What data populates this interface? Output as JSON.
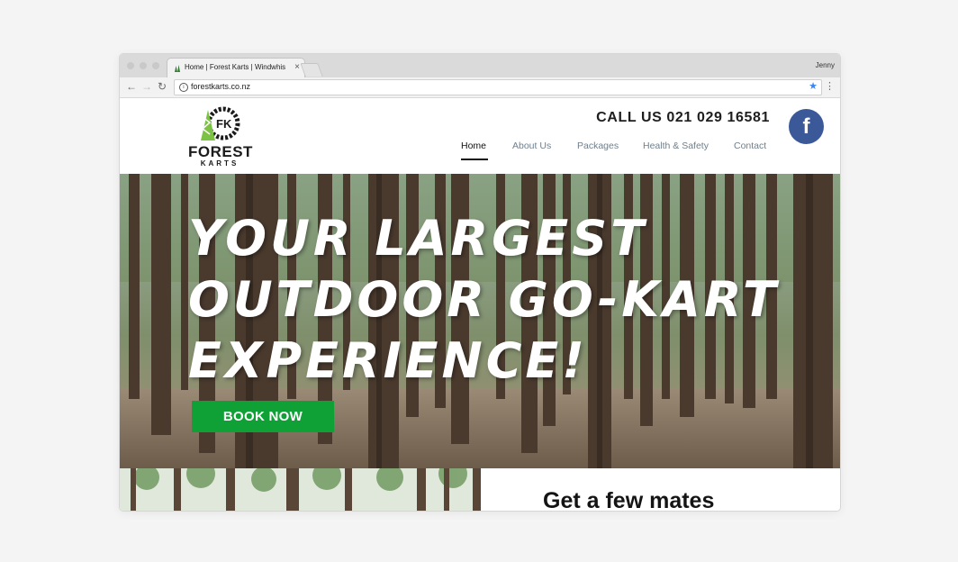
{
  "browser": {
    "tab_title": "Home | Forest Karts | Windwhistle",
    "tab_close": "×",
    "profile_name": "Jenny",
    "url": "forestkarts.co.nz",
    "back_icon": "←",
    "forward_icon": "→",
    "reload_icon": "↻",
    "info_icon": "i",
    "bookmark_icon": "★",
    "menu_icon": "⋮"
  },
  "site": {
    "logo_monogram": "FK",
    "logo_word1": "FOREST",
    "logo_word2": "KARTS",
    "call_us": "CALL US 021 029 16581",
    "facebook_icon": "f",
    "nav": [
      "Home",
      "About Us",
      "Packages",
      "Health & Safety",
      "Contact"
    ],
    "active_nav": "Home"
  },
  "hero": {
    "headline_lines": [
      "YOUR LARGEST",
      "OUTDOOR GO-KART",
      "EXPERIENCE!"
    ],
    "cta_label": "BOOK NOW"
  },
  "lower": {
    "heading": "Get a few mates"
  },
  "colors": {
    "cta_green": "#0fa135",
    "facebook_blue": "#3b5998",
    "nav_gray": "#6f7f8c",
    "bookmark_blue": "#3b86f0"
  }
}
